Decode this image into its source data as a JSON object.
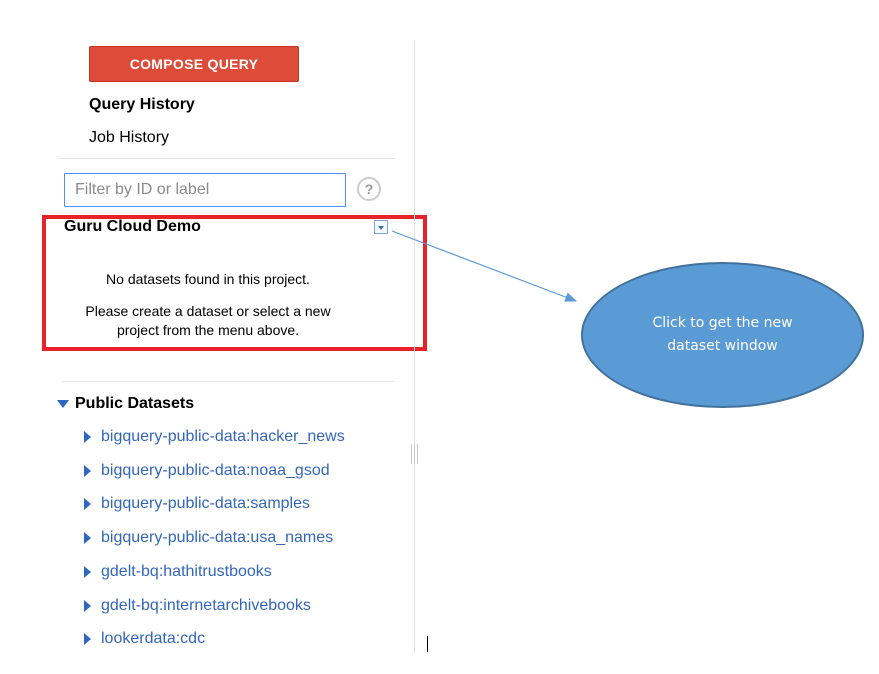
{
  "sidebar": {
    "compose_button": "COMPOSE QUERY",
    "nav": [
      {
        "label": "Query History",
        "active": true
      },
      {
        "label": "Job History",
        "active": false
      }
    ],
    "filter": {
      "placeholder": "Filter by ID or label",
      "value": ""
    },
    "help_icon": {
      "glyph": "?",
      "icon": "help-icon"
    }
  },
  "project": {
    "name": "Guru Cloud Demo",
    "dropdown_icon": "dropdown-arrow-icon",
    "empty_message": "No datasets found in this project.",
    "hint_line1": "Please create a dataset or select a new",
    "hint_line2": "project from the menu above.",
    "highlight_color": "#e8212b"
  },
  "public_datasets": {
    "title": "Public Datasets",
    "expanded": true,
    "items": [
      "bigquery-public-data:hacker_news",
      "bigquery-public-data:noaa_gsod",
      "bigquery-public-data:samples",
      "bigquery-public-data:usa_names",
      "gdelt-bq:hathitrustbooks",
      "gdelt-bq:internetarchivebooks",
      "lookerdata:cdc"
    ]
  },
  "annotation": {
    "line1": "Click to get the new",
    "line2": "dataset window",
    "fill_color": "#5b9bd5",
    "arrow_color": "#5b9bd5"
  },
  "colors": {
    "accent_red": "#dd4b39",
    "link_blue": "#3366bb",
    "input_focus": "#4d90fe"
  }
}
